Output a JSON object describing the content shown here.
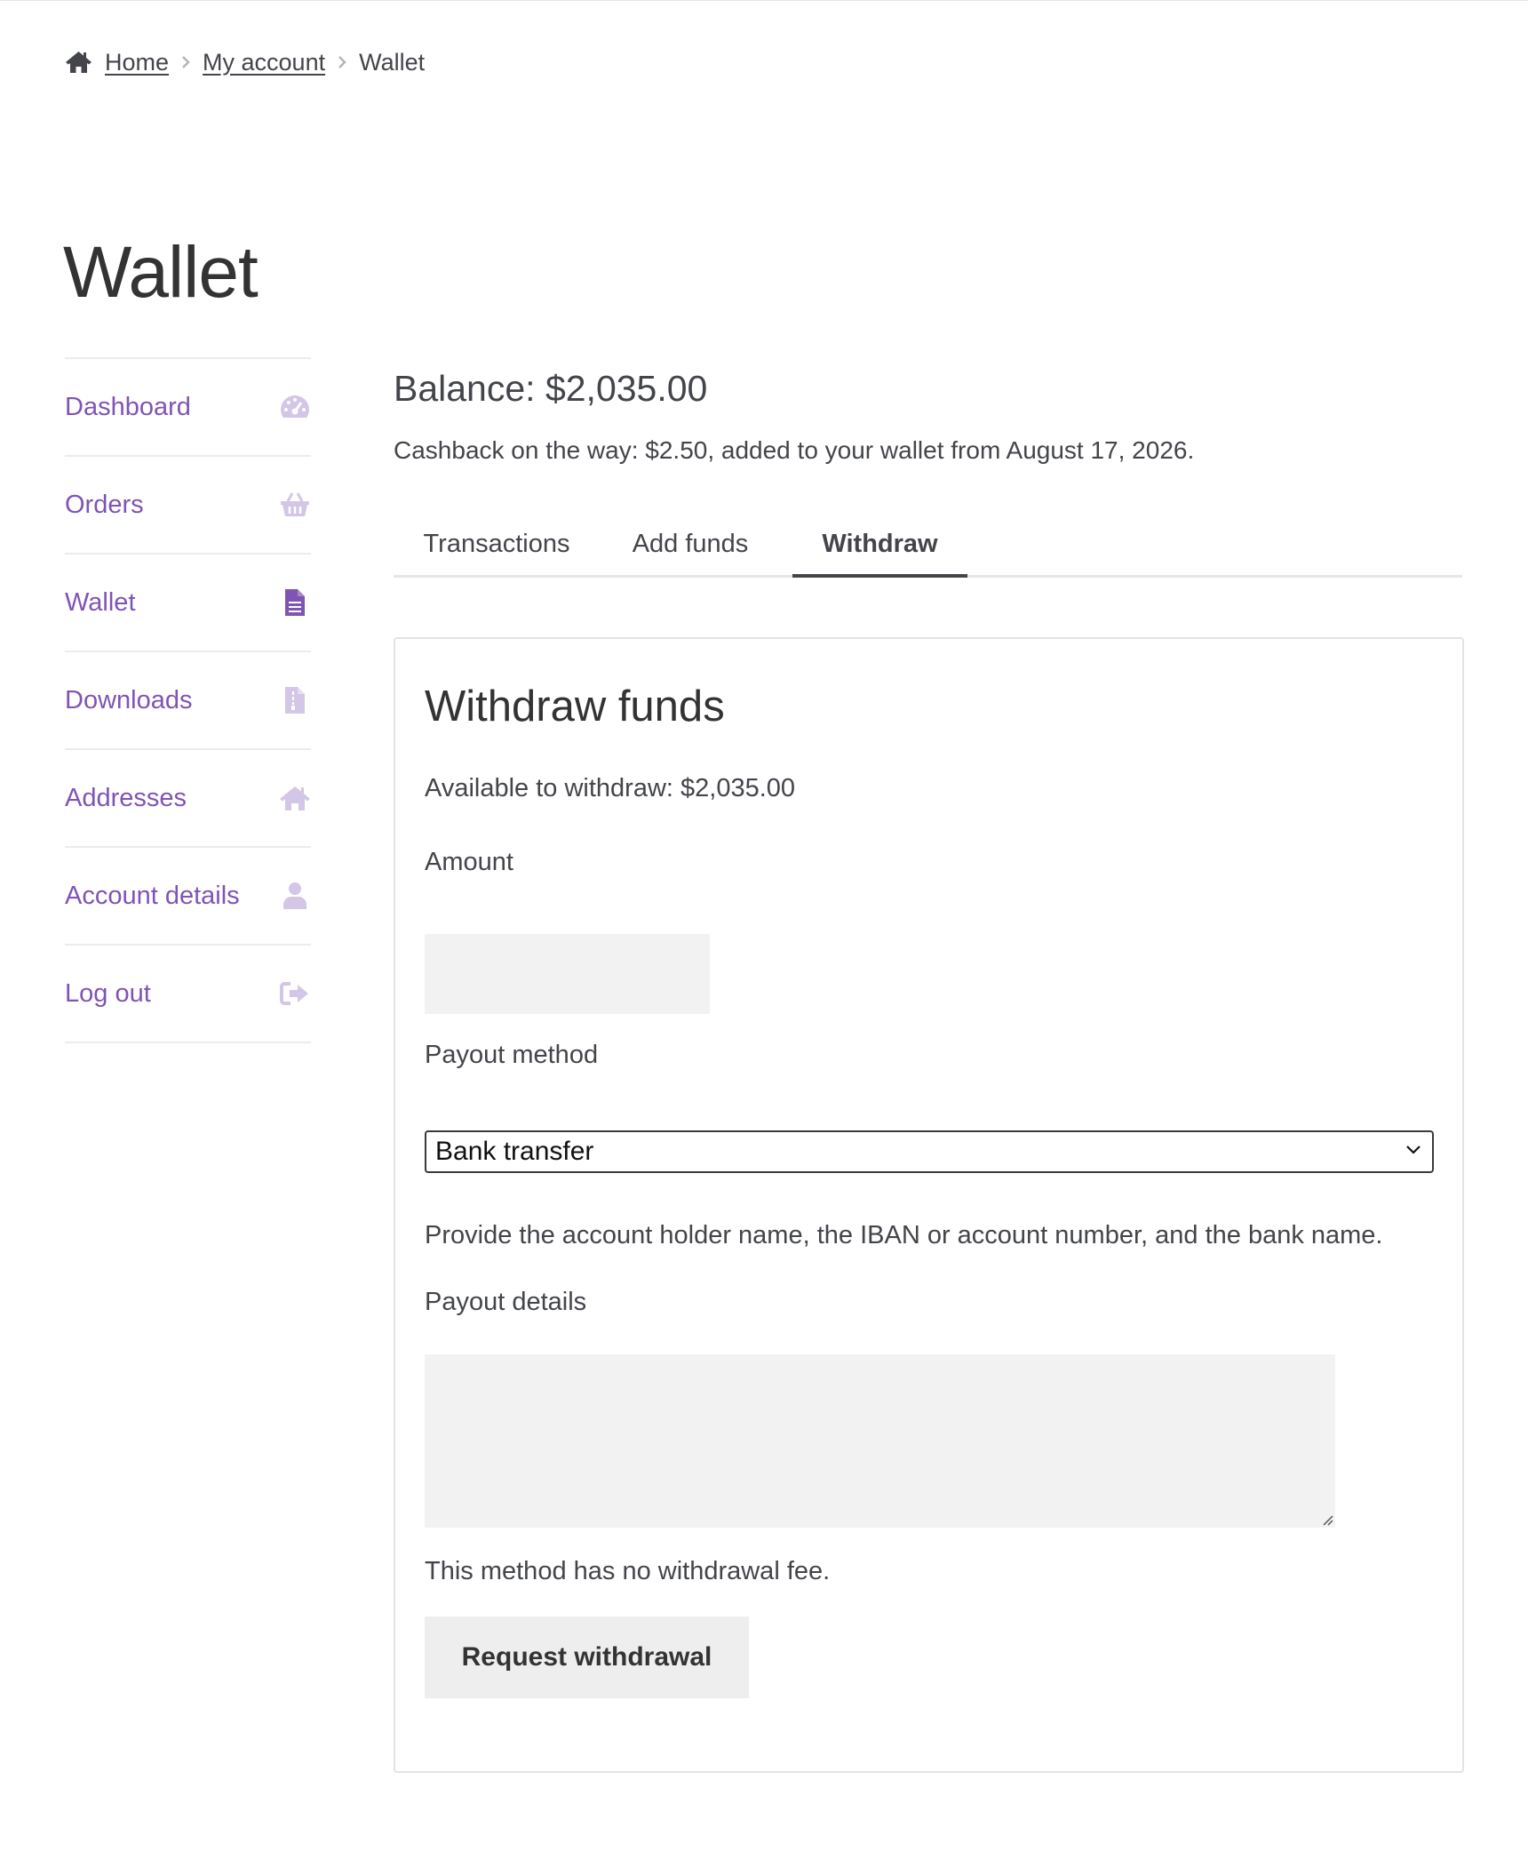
{
  "breadcrumb": {
    "home": "Home",
    "my_account": "My account",
    "current": "Wallet"
  },
  "page": {
    "title": "Wallet"
  },
  "nav": {
    "items": [
      {
        "label": "Dashboard",
        "icon": "dashboard-gauge-icon"
      },
      {
        "label": "Orders",
        "icon": "basket-icon"
      },
      {
        "label": "Wallet",
        "icon": "document-icon"
      },
      {
        "label": "Downloads",
        "icon": "file-archive-icon"
      },
      {
        "label": "Addresses",
        "icon": "home-icon"
      },
      {
        "label": "Account details",
        "icon": "user-icon"
      },
      {
        "label": "Log out",
        "icon": "sign-out-icon"
      }
    ],
    "active_index": 2
  },
  "wallet": {
    "balance": "Balance: $2,035.00",
    "cashback": "Cashback on the way: $2.50, added to your wallet from August 17, 2026."
  },
  "tabs": {
    "items": [
      "Transactions",
      "Add funds",
      "Withdraw"
    ],
    "active": "Withdraw"
  },
  "withdraw": {
    "heading": "Withdraw funds",
    "available": "Available to withdraw: $2,035.00",
    "amount_label": "Amount",
    "amount_value": "",
    "payout_method_label": "Payout method",
    "payout_method_selected": "Bank transfer",
    "payout_help": "Provide the account holder name, the IBAN or account number, and the bank name.",
    "payout_details_label": "Payout details",
    "payout_details_value": "",
    "fee_note": "This method has no withdrawal fee.",
    "submit_label": "Request withdrawal"
  },
  "colors": {
    "accent": "#7f54b3",
    "accent_active_icon": "#7f54b3",
    "accent_inactive_icon": "#d3c6e6",
    "text": "#43454b",
    "input_bg": "#f2f2f2"
  }
}
